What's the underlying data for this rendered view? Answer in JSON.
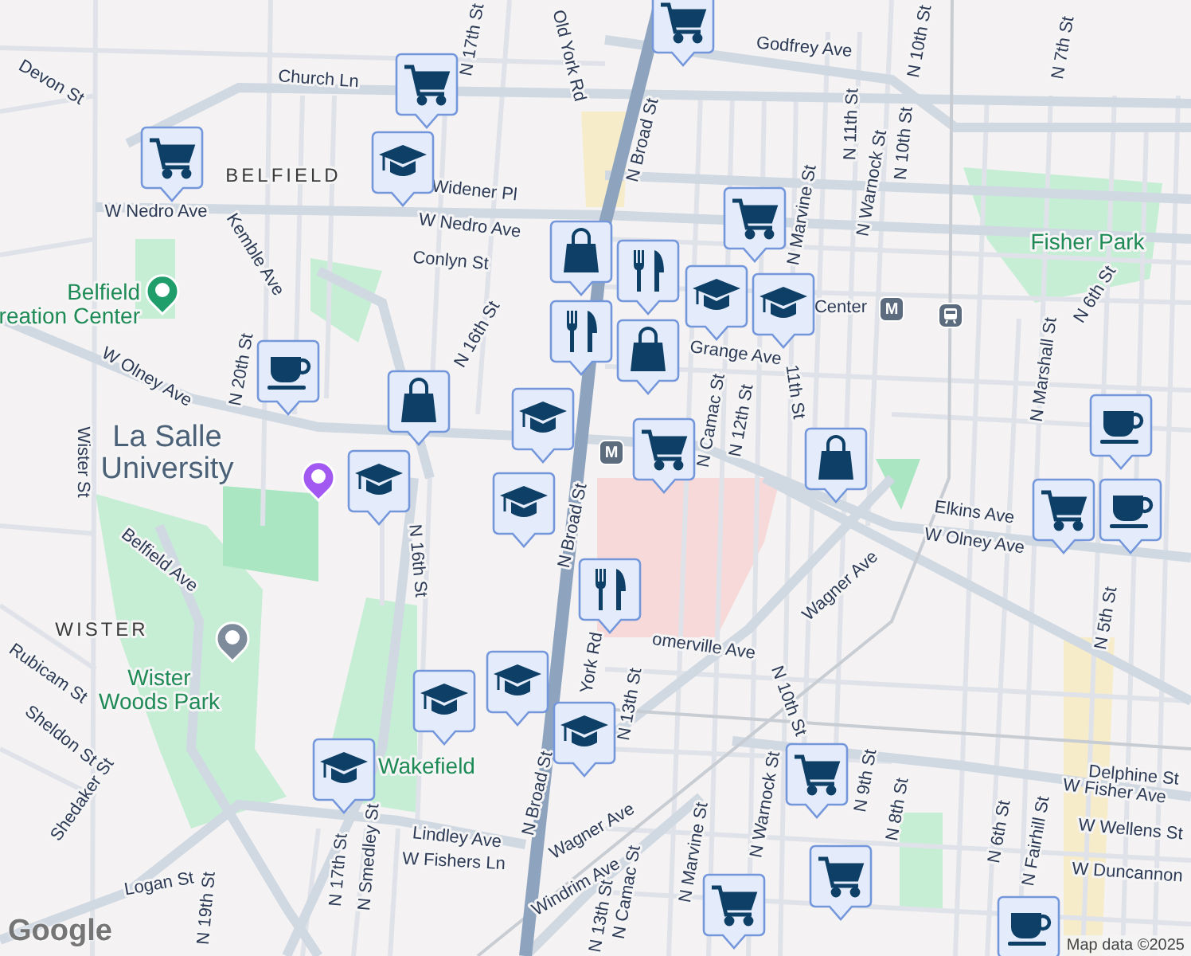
{
  "labels": [
    {
      "kind": "street",
      "text": "Devon St"
    },
    {
      "kind": "street",
      "text": "Church Ln"
    },
    {
      "kind": "street",
      "text": "W Nedro Ave"
    },
    {
      "kind": "street",
      "text": "Kemble Ave"
    },
    {
      "kind": "street",
      "text": "Widener Pl"
    },
    {
      "kind": "street",
      "text": "W Nedro Ave"
    },
    {
      "kind": "street",
      "text": "Conlyn St"
    },
    {
      "kind": "street",
      "text": "W Olney Ave"
    },
    {
      "kind": "street",
      "text": "N 20th St"
    },
    {
      "kind": "street",
      "text": "N 17th St"
    },
    {
      "kind": "street",
      "text": "Old York Rd"
    },
    {
      "kind": "street",
      "text": "N Broad St"
    },
    {
      "kind": "street",
      "text": "N 16th St"
    },
    {
      "kind": "street",
      "text": "Godfrey Ave"
    },
    {
      "kind": "street",
      "text": "N 11th St"
    },
    {
      "kind": "street",
      "text": "N Warnock St"
    },
    {
      "kind": "street",
      "text": "N 10th St"
    },
    {
      "kind": "street",
      "text": "N 10th St"
    },
    {
      "kind": "street",
      "text": "N Marvine St"
    },
    {
      "kind": "street",
      "text": "N 7th St"
    },
    {
      "kind": "street",
      "text": "N 6th St"
    },
    {
      "kind": "street",
      "text": "Center"
    },
    {
      "kind": "street",
      "text": "Grange Ave"
    },
    {
      "kind": "street",
      "text": "N Camac St"
    },
    {
      "kind": "street",
      "text": "N 12th St"
    },
    {
      "kind": "street",
      "text": "11th St"
    },
    {
      "kind": "street",
      "text": "N Marshall St"
    },
    {
      "kind": "street",
      "text": "Elkins Ave"
    },
    {
      "kind": "street",
      "text": "W Olney Ave"
    },
    {
      "kind": "street",
      "text": "Wagner Ave"
    },
    {
      "kind": "street",
      "text": "omerville Ave"
    },
    {
      "kind": "street",
      "text": "N 13th St"
    },
    {
      "kind": "street",
      "text": "N 10th St"
    },
    {
      "kind": "street",
      "text": "N 5th St"
    },
    {
      "kind": "street",
      "text": "Delphine St"
    },
    {
      "kind": "street",
      "text": "W Fisher Ave"
    },
    {
      "kind": "street",
      "text": "W Wellens St"
    },
    {
      "kind": "street",
      "text": "W Duncannon"
    },
    {
      "kind": "street",
      "text": "N 9th St"
    },
    {
      "kind": "street",
      "text": "N 8th St"
    },
    {
      "kind": "street",
      "text": "N 6th St"
    },
    {
      "kind": "street",
      "text": "N Fairhill St"
    },
    {
      "kind": "street",
      "text": "N Marvine St"
    },
    {
      "kind": "street",
      "text": "N Warnock St"
    },
    {
      "kind": "street",
      "text": "N Camac St"
    },
    {
      "kind": "street",
      "text": "N 13th St"
    },
    {
      "kind": "street",
      "text": "N Broad St"
    },
    {
      "kind": "street",
      "text": "N Broad St"
    },
    {
      "kind": "street",
      "text": "York Rd"
    },
    {
      "kind": "street",
      "text": "Wister St"
    },
    {
      "kind": "street",
      "text": "Belfield Ave"
    },
    {
      "kind": "street",
      "text": "Rubicam St"
    },
    {
      "kind": "street",
      "text": "Sheldon St"
    },
    {
      "kind": "street",
      "text": "Shedaker St"
    },
    {
      "kind": "street",
      "text": "Logan St"
    },
    {
      "kind": "street",
      "text": "Lindley Ave"
    },
    {
      "kind": "street",
      "text": "W Fishers Ln"
    },
    {
      "kind": "street",
      "text": "Wagner Ave"
    },
    {
      "kind": "street",
      "text": "Windrim Ave"
    },
    {
      "kind": "street",
      "text": "N 17th St"
    },
    {
      "kind": "street",
      "text": "N Smedley St"
    },
    {
      "kind": "street",
      "text": "N 16th St"
    },
    {
      "kind": "street",
      "text": "N 19th St"
    },
    {
      "kind": "area",
      "text": "BELFIELD"
    },
    {
      "kind": "area",
      "text": "WISTER"
    },
    {
      "kind": "park",
      "text": "Fisher Park"
    },
    {
      "kind": "park",
      "text": "Wakefield"
    },
    {
      "kind": "park",
      "lines": [
        "Belfield",
        "reation Center"
      ]
    },
    {
      "kind": "place",
      "lines": [
        "La Salle",
        "University"
      ]
    },
    {
      "kind": "park",
      "lines": [
        "Wister",
        "Woods Park"
      ]
    }
  ],
  "pois": [
    {
      "kind": "park"
    },
    {
      "kind": "university"
    },
    {
      "kind": "school"
    }
  ],
  "transit": [
    {
      "kind": "metro",
      "label": "M"
    },
    {
      "kind": "metro",
      "label": "M"
    },
    {
      "kind": "rail"
    }
  ],
  "markers": [
    {
      "kind": "cart"
    },
    {
      "kind": "cart"
    },
    {
      "kind": "grad"
    },
    {
      "kind": "cart"
    },
    {
      "kind": "cup"
    },
    {
      "kind": "bag"
    },
    {
      "kind": "grad"
    },
    {
      "kind": "grad"
    },
    {
      "kind": "grad"
    },
    {
      "kind": "cart"
    },
    {
      "kind": "bag"
    },
    {
      "kind": "fork"
    },
    {
      "kind": "fork"
    },
    {
      "kind": "grad"
    },
    {
      "kind": "grad"
    },
    {
      "kind": "bag"
    },
    {
      "kind": "cart"
    },
    {
      "kind": "bag"
    },
    {
      "kind": "cup"
    },
    {
      "kind": "cart"
    },
    {
      "kind": "cup"
    },
    {
      "kind": "fork"
    },
    {
      "kind": "grad"
    },
    {
      "kind": "grad"
    },
    {
      "kind": "grad"
    },
    {
      "kind": "grad"
    },
    {
      "kind": "cart"
    },
    {
      "kind": "cart"
    },
    {
      "kind": "cart"
    },
    {
      "kind": "cup"
    }
  ],
  "logo": "Google",
  "attribution": "Map data ©2025"
}
